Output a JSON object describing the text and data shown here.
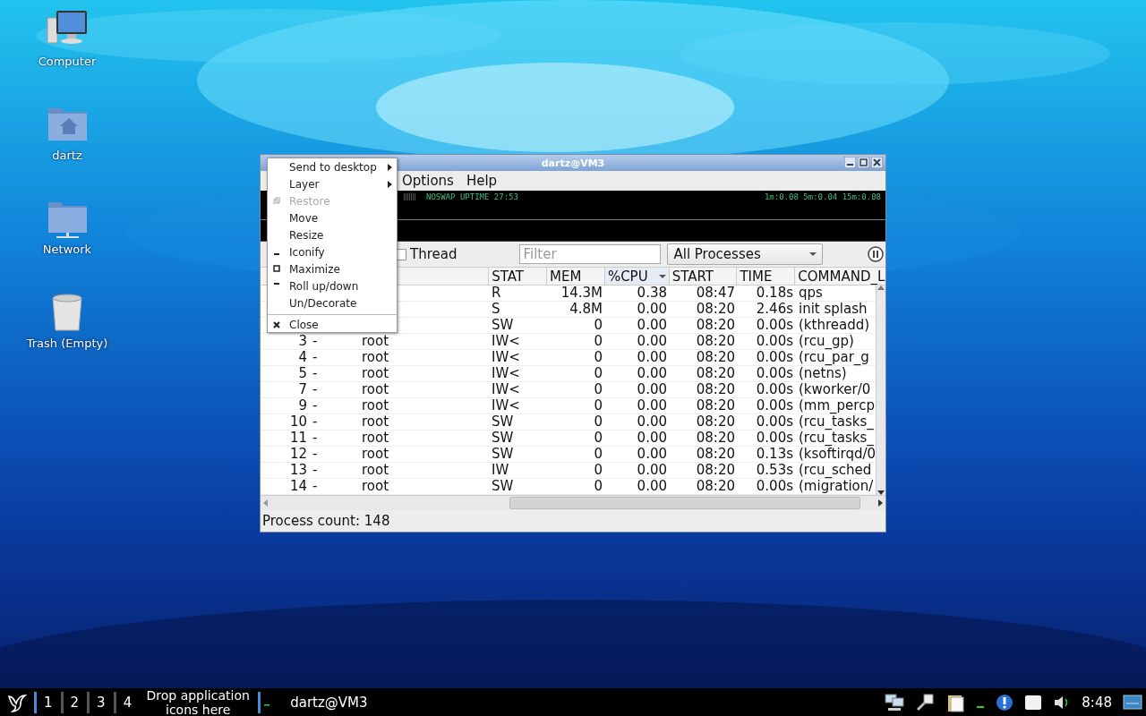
{
  "desktop_icons": [
    {
      "kind": "computer",
      "label": "Computer"
    },
    {
      "kind": "home",
      "label": "dartz"
    },
    {
      "kind": "network",
      "label": "Network"
    },
    {
      "kind": "trash",
      "label": "Trash (Empty)"
    }
  ],
  "window": {
    "title": "dartz@VM3",
    "menu_bar": [
      "Options",
      "Help"
    ],
    "info_panel": {
      "left": "NOSWAP  UPTIME 27:53",
      "right": "1m:0.08 5m:0.04 15m:0.08"
    },
    "toolbar": {
      "thread_checkbox": {
        "label": "Thread",
        "checked": false
      },
      "filter": {
        "placeholder": "Filter"
      },
      "process_filter": "All Processes"
    },
    "table": {
      "columns": [
        {},
        {},
        {},
        {
          "label": "STAT",
          "sorted": false
        },
        {
          "label": "MEM",
          "sorted": false
        },
        {
          "label": "%CPU",
          "sorted": true
        },
        {
          "label": "START",
          "sorted": false
        },
        {
          "label": "TIME",
          "sorted": false
        },
        {
          "label": "COMMAND_L",
          "sorted": false
        }
      ],
      "rows": [
        [
          "",
          "",
          "",
          "R",
          "14.3M",
          "0.38",
          "08:47",
          "0.18s",
          "qps"
        ],
        [
          "",
          "",
          "",
          "S",
          "4.8M",
          "0.00",
          "08:20",
          "2.46s",
          "init splash"
        ],
        [
          "",
          "",
          "",
          "SW",
          "0",
          "0.00",
          "08:20",
          "0.00s",
          "(kthreadd)"
        ],
        [
          "3",
          "-",
          "root",
          "IW<",
          "0",
          "0.00",
          "08:20",
          "0.00s",
          "(rcu_gp)"
        ],
        [
          "4",
          "-",
          "root",
          "IW<",
          "0",
          "0.00",
          "08:20",
          "0.00s",
          "(rcu_par_g"
        ],
        [
          "5",
          "-",
          "root",
          "IW<",
          "0",
          "0.00",
          "08:20",
          "0.00s",
          "(netns)"
        ],
        [
          "7",
          "-",
          "root",
          "IW<",
          "0",
          "0.00",
          "08:20",
          "0.00s",
          "(kworker/0"
        ],
        [
          "9",
          "-",
          "root",
          "IW<",
          "0",
          "0.00",
          "08:20",
          "0.00s",
          "(mm_percp"
        ],
        [
          "10",
          "-",
          "root",
          "SW",
          "0",
          "0.00",
          "08:20",
          "0.00s",
          "(rcu_tasks_"
        ],
        [
          "11",
          "-",
          "root",
          "SW",
          "0",
          "0.00",
          "08:20",
          "0.00s",
          "(rcu_tasks_"
        ],
        [
          "12",
          "-",
          "root",
          "SW",
          "0",
          "0.00",
          "08:20",
          "0.13s",
          "(ksoftirqd/0"
        ],
        [
          "13",
          "-",
          "root",
          "IW",
          "0",
          "0.00",
          "08:20",
          "0.53s",
          "(rcu_sched"
        ],
        [
          "14",
          "-",
          "root",
          "SW",
          "0",
          "0.00",
          "08:20",
          "0.00s",
          "(migration/"
        ]
      ]
    },
    "status_bar": "Process count: 148"
  },
  "context_menu": {
    "sections": [
      [
        {
          "label": "Send to desktop",
          "kind": "submenu",
          "disabled": false
        },
        {
          "label": "Layer",
          "kind": "submenu",
          "disabled": false
        },
        {
          "label": "Restore",
          "kind": "restore",
          "disabled": true
        },
        {
          "label": "Move",
          "kind": "plain",
          "disabled": false
        },
        {
          "label": "Resize",
          "kind": "plain",
          "disabled": false
        },
        {
          "label": "Iconify",
          "kind": "iconify",
          "disabled": false
        },
        {
          "label": "Maximize",
          "kind": "maximize",
          "disabled": false
        },
        {
          "label": "Roll up/down",
          "kind": "shade",
          "disabled": false
        },
        {
          "label": "Un/Decorate",
          "kind": "plain",
          "disabled": false
        }
      ],
      [
        {
          "label": "Close",
          "kind": "close",
          "disabled": false
        }
      ]
    ]
  },
  "taskbar": {
    "desktops": [
      {
        "label": "1",
        "selected": true
      },
      {
        "label": "2",
        "selected": false
      },
      {
        "label": "3",
        "selected": false
      },
      {
        "label": "4",
        "selected": false
      }
    ],
    "launch_hint": "Drop application icons here",
    "tasks": [
      "dartz@VM3"
    ],
    "clock": "8:48"
  }
}
